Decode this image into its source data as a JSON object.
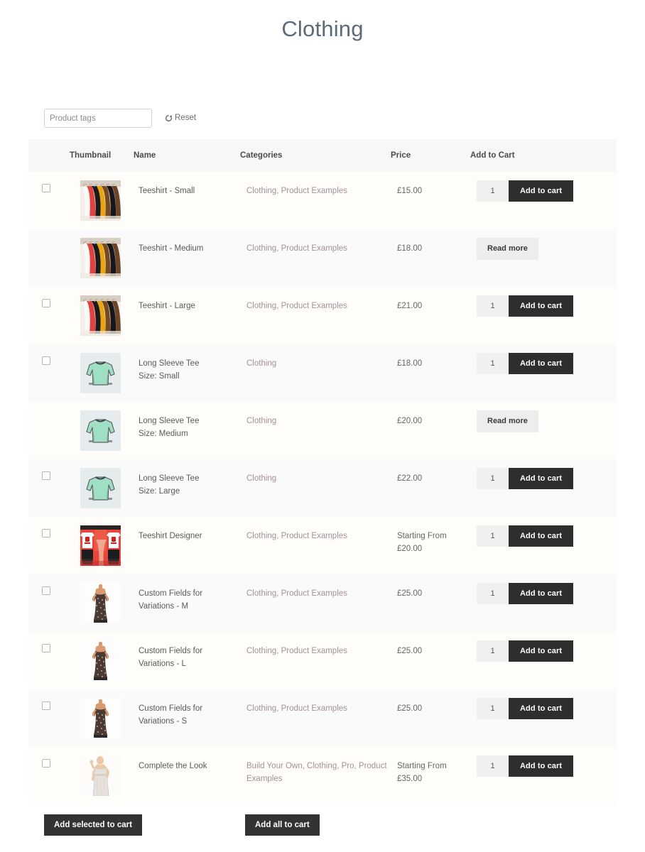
{
  "page": {
    "title": "Clothing"
  },
  "filter": {
    "tags_placeholder": "Product tags",
    "tags_value": "",
    "reset_label": "Reset",
    "reset_icon": "refresh-icon"
  },
  "table": {
    "headers": {
      "checkbox": "",
      "thumbnail": "Thumbnail",
      "name": "Name",
      "categories": "Categories",
      "price": "Price",
      "add_to_cart": "Add to Cart"
    },
    "rows": [
      {
        "has_checkbox": true,
        "thumb": "teeshirt-rack-thumbnail",
        "name": "Teeshirt - Small",
        "categories": "Clothing, Product Examples",
        "price": "£15.00",
        "price_prefix": "",
        "action": "add",
        "qty": "1",
        "add_label": "Add to cart",
        "readmore_label": ""
      },
      {
        "has_checkbox": false,
        "thumb": "teeshirt-rack-thumbnail",
        "name": "Teeshirt - Medium",
        "categories": "Clothing, Product Examples",
        "price": "£18.00",
        "price_prefix": "",
        "action": "readmore",
        "qty": "",
        "add_label": "",
        "readmore_label": "Read more"
      },
      {
        "has_checkbox": true,
        "thumb": "teeshirt-rack-thumbnail",
        "name": "Teeshirt - Large",
        "categories": "Clothing, Product Examples",
        "price": "£21.00",
        "price_prefix": "",
        "action": "add",
        "qty": "1",
        "add_label": "Add to cart",
        "readmore_label": ""
      },
      {
        "has_checkbox": true,
        "thumb": "long-sleeve-tee-thumbnail",
        "name": "Long Sleeve Tee\nSize: Small",
        "categories": "Clothing",
        "price": "£18.00",
        "price_prefix": "",
        "action": "add",
        "qty": "1",
        "add_label": "Add to cart",
        "readmore_label": ""
      },
      {
        "has_checkbox": false,
        "thumb": "long-sleeve-tee-thumbnail",
        "name": "Long Sleeve Tee\nSize: Medium",
        "categories": "Clothing",
        "price": "£20.00",
        "price_prefix": "",
        "action": "readmore",
        "qty": "",
        "add_label": "",
        "readmore_label": "Read more"
      },
      {
        "has_checkbox": true,
        "thumb": "long-sleeve-tee-thumbnail",
        "name": "Long Sleeve Tee\nSize: Large",
        "categories": "Clothing",
        "price": "£22.00",
        "price_prefix": "",
        "action": "add",
        "qty": "1",
        "add_label": "Add to cart",
        "readmore_label": ""
      },
      {
        "has_checkbox": true,
        "thumb": "teeshirt-designer-thumbnail",
        "name": "Teeshirt Designer",
        "categories": "Clothing, Product Examples",
        "price": "£20.00",
        "price_prefix": "Starting From",
        "action": "add",
        "qty": "1",
        "add_label": "Add to cart",
        "readmore_label": ""
      },
      {
        "has_checkbox": true,
        "thumb": "maxi-dress-thumbnail",
        "name": "Custom Fields for\nVariations - M",
        "categories": "Clothing, Product Examples",
        "price": "£25.00",
        "price_prefix": "",
        "action": "add",
        "qty": "1",
        "add_label": "Add to cart",
        "readmore_label": ""
      },
      {
        "has_checkbox": true,
        "thumb": "maxi-dress-thumbnail",
        "name": "Custom Fields for\nVariations - L",
        "categories": "Clothing, Product Examples",
        "price": "£25.00",
        "price_prefix": "",
        "action": "add",
        "qty": "1",
        "add_label": "Add to cart",
        "readmore_label": ""
      },
      {
        "has_checkbox": true,
        "thumb": "maxi-dress-thumbnail",
        "name": "Custom Fields for\nVariations - S",
        "categories": "Clothing, Product Examples",
        "price": "£25.00",
        "price_prefix": "",
        "action": "add",
        "qty": "1",
        "add_label": "Add to cart",
        "readmore_label": ""
      },
      {
        "has_checkbox": true,
        "thumb": "white-dress-thumbnail",
        "name": "Complete the Look",
        "categories": "Build Your Own, Clothing, Pro, Product Examples",
        "price": "£35.00",
        "price_prefix": "Starting From",
        "action": "add",
        "qty": "1",
        "add_label": "Add to cart",
        "readmore_label": ""
      }
    ]
  },
  "footer": {
    "add_selected_label": "Add selected to cart",
    "add_all_label": "Add all to cart"
  },
  "colors": {
    "title": "#5d6a78",
    "header_bg": "#f7f7f7",
    "row_odd": "#fffdfa",
    "row_even": "#fafafa",
    "category_link": "#a49099",
    "button_dark": "#2e2e2e",
    "button_light": "#ededed",
    "qty_bg": "#f0f0f0"
  }
}
